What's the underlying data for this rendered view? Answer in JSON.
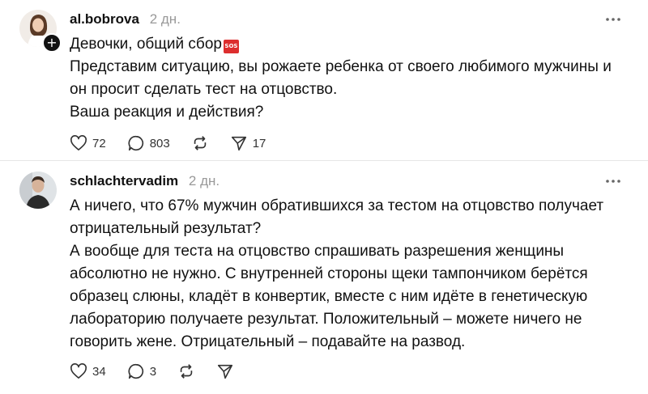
{
  "posts": [
    {
      "username": "al.bobrova",
      "time": "2 дн.",
      "text_lines": [
        "Девочки, общий сбор",
        "Представим ситуацию, вы рожаете ребенка от своего любимого мужчины и",
        "он просит сделать тест на отцовство.",
        "Ваша реакция и действия?"
      ],
      "emoji": "SOS",
      "likes": "72",
      "comments": "803",
      "shares": "17"
    },
    {
      "username": "schlachtervadim",
      "time": "2 дн.",
      "text_lines": [
        "А ничего, что 67% мужчин обратившихся за тестом на отцовство получает",
        "отрицательный результат?",
        "А вообще для теста на отцовство спрашивать разрешения женщины",
        "абсолютно не нужно. С внутренней стороны щеки тампончиком берётся",
        "образец слюны, кладёт в конвертик, вместе с ним идёте в генетическую",
        "лабораторию получаете результат. Положительный – можете ничего не",
        "говорить жене. Отрицательный – подавайте на развод."
      ],
      "likes": "34",
      "comments": "3"
    }
  ]
}
